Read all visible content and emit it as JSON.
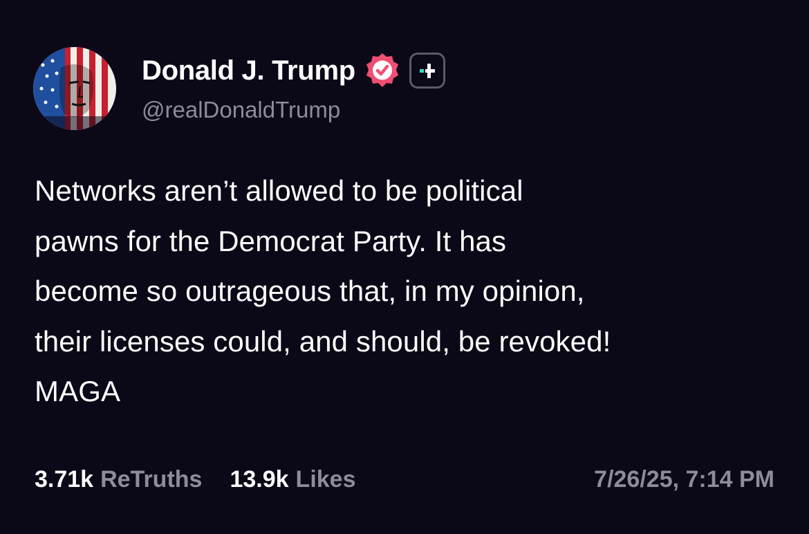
{
  "author": {
    "display_name": "Donald J. Trump",
    "handle": "@realDonaldTrump",
    "verified_badge_icon": "verified-check-icon",
    "verified_color": "#f14e73",
    "plus_badge_icon": "plus-icon",
    "plus_accent_color": "#2fe0c4"
  },
  "post": {
    "lines": [
      "Networks aren’t allowed to be political",
      "pawns for the Democrat Party. It has",
      "become so outrageous that, in my opinion,",
      "their licenses could, and should, be revoked!",
      "MAGA"
    ]
  },
  "stats": {
    "retruths_count": "3.71k",
    "retruths_label": "ReTruths",
    "likes_count": "13.9k",
    "likes_label": "Likes",
    "timestamp": "7/26/25, 7:14 PM"
  },
  "colors": {
    "background": "#0b0818",
    "secondary_text": "#8e8c99"
  }
}
